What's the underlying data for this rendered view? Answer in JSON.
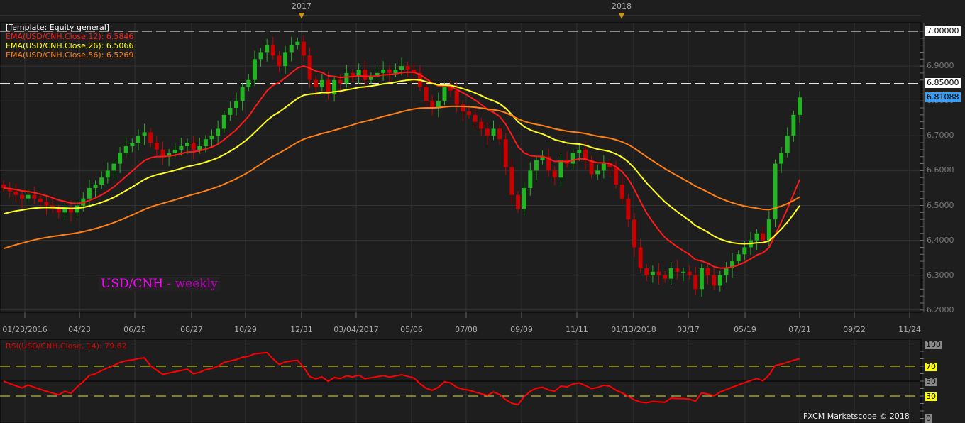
{
  "header": {
    "years": [
      {
        "label": "2017"
      },
      {
        "label": "2018"
      }
    ]
  },
  "legend": {
    "template": "[Template: Equity general]",
    "ema12": "EMA(USD/CNH.Close,12): 6.5846",
    "ema26": "EMA(USD/CNH.Close,26): 6.5066",
    "ema56": "EMA(USD/CNH.Close,56): 6.5269"
  },
  "chart_title": {
    "symbol": "USD/CNH",
    "period": " - weekly"
  },
  "price_axis": {
    "ticks": [
      "7.0000",
      "6.9000",
      "6.8000",
      "6.7000",
      "6.6000",
      "6.5000",
      "6.4000",
      "6.3000",
      "6.2000"
    ],
    "level_7": "7.00000",
    "level_685": "6.85000",
    "current": "6.81088"
  },
  "date_axis": [
    "01/23/2016",
    "04/23",
    "06/25",
    "08/27",
    "10/29",
    "12/31",
    "03/04/2017",
    "05/06",
    "07/08",
    "09/09",
    "11/11",
    "01/13/2018",
    "03/17",
    "05/19",
    "07/21",
    "09/22",
    "11/24"
  ],
  "rsi": {
    "legend": "RSI(USD/CNH.Close, 14): 79.62",
    "labels": [
      "100",
      "70",
      "50",
      "30",
      "0"
    ]
  },
  "credit": "FXCM Marketscope © 2018",
  "colors": {
    "bull": "#22b422",
    "bear": "#c80000",
    "ema12": "#ff1a1a",
    "ema26": "#ffff1e",
    "ema56": "#ff7f14",
    "rsi": "#ff0000",
    "current": "#3c9cf0"
  },
  "chart_data": {
    "type": "candlestick",
    "title": "USD/CNH - weekly",
    "ylim": [
      6.2,
      7.0
    ],
    "closes": [
      6.55,
      6.54,
      6.53,
      6.52,
      6.53,
      6.52,
      6.51,
      6.5,
      6.49,
      6.48,
      6.49,
      6.48,
      6.5,
      6.52,
      6.55,
      6.56,
      6.58,
      6.6,
      6.62,
      6.65,
      6.67,
      6.68,
      6.7,
      6.71,
      6.68,
      6.66,
      6.64,
      6.65,
      6.66,
      6.67,
      6.68,
      6.66,
      6.67,
      6.69,
      6.7,
      6.72,
      6.76,
      6.78,
      6.8,
      6.84,
      6.86,
      6.92,
      6.94,
      6.96,
      6.93,
      6.9,
      6.94,
      6.96,
      6.97,
      6.93,
      6.86,
      6.84,
      6.86,
      6.82,
      6.86,
      6.85,
      6.88,
      6.87,
      6.89,
      6.86,
      6.87,
      6.88,
      6.89,
      6.88,
      6.89,
      6.9,
      6.89,
      6.88,
      6.84,
      6.8,
      6.78,
      6.8,
      6.84,
      6.83,
      6.79,
      6.77,
      6.76,
      6.74,
      6.72,
      6.7,
      6.72,
      6.69,
      6.61,
      6.53,
      6.49,
      6.55,
      6.6,
      6.63,
      6.64,
      6.6,
      6.58,
      6.63,
      6.62,
      6.65,
      6.66,
      6.63,
      6.59,
      6.6,
      6.62,
      6.61,
      6.56,
      6.52,
      6.46,
      6.38,
      6.32,
      6.3,
      6.31,
      6.3,
      6.29,
      6.32,
      6.31,
      6.31,
      6.3,
      6.26,
      6.32,
      6.3,
      6.27,
      6.3,
      6.32,
      6.34,
      6.36,
      6.38,
      6.4,
      6.42,
      6.4,
      6.46,
      6.62,
      6.65,
      6.7,
      6.76,
      6.81
    ],
    "ema_seed": {
      "ema12": 6.55,
      "ema26": 6.47,
      "ema56": 6.37
    },
    "rsi_levels": [
      30,
      50,
      70
    ]
  }
}
